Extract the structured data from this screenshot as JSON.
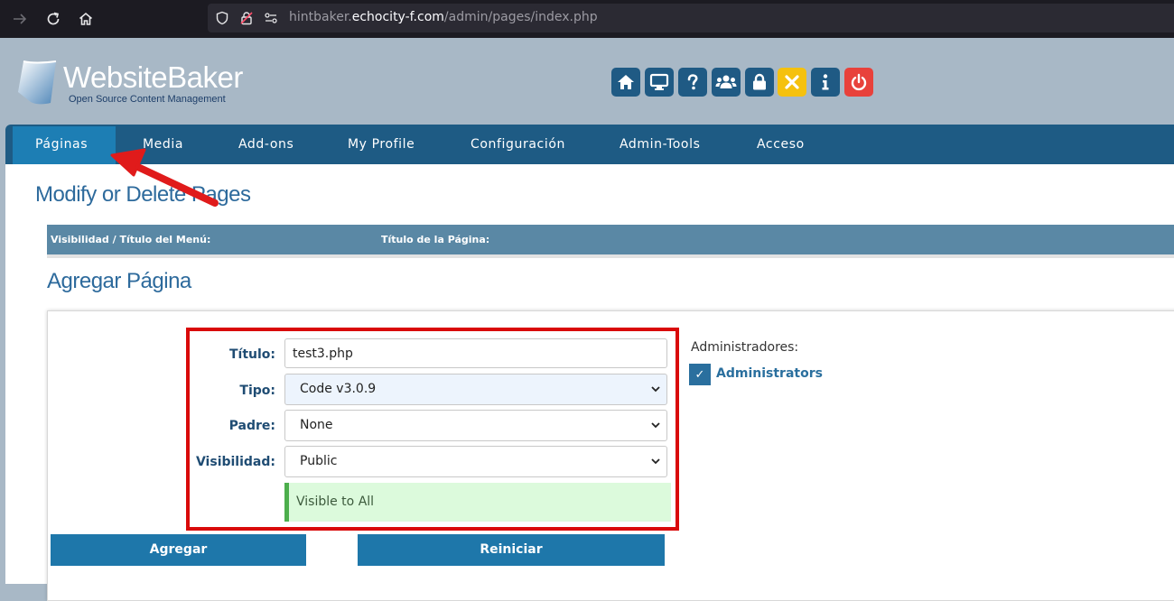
{
  "browser": {
    "url_host_prefix": "hintbaker.",
    "url_domain": "echocity-f.com",
    "url_path": "/admin/pages/index.php"
  },
  "logo": {
    "title": "WebsiteBaker",
    "subtitle": "Open Source Content Management"
  },
  "toolbar": {
    "buttons": [
      {
        "name": "home",
        "color": "#1f5a84"
      },
      {
        "name": "view",
        "color": "#1f5a84"
      },
      {
        "name": "help",
        "color": "#1f5a84"
      },
      {
        "name": "users",
        "color": "#1f5a84"
      },
      {
        "name": "lock",
        "color": "#1f5a84"
      },
      {
        "name": "close",
        "color": "#f5c10e"
      },
      {
        "name": "info",
        "color": "#1f5a84"
      },
      {
        "name": "logout",
        "color": "#e8413b"
      }
    ]
  },
  "nav": {
    "items": [
      "Páginas",
      "Media",
      "Add-ons",
      "My Profile",
      "Configuración",
      "Admin-Tools",
      "Acceso"
    ],
    "active": "Páginas"
  },
  "main": {
    "title_modify": "Modify or Delete Pages",
    "table_headers": [
      "Visibilidad / Título del Menú:",
      "Título de la Página:"
    ],
    "title_add": "Agregar Página"
  },
  "form": {
    "titulo_label": "Título:",
    "titulo_value": "test3.php",
    "tipo_label": "Tipo:",
    "tipo_value": "Code v3.0.9",
    "padre_label": "Padre:",
    "padre_value": "None",
    "visibilidad_label": "Visibilidad:",
    "visibilidad_value": "Public",
    "visibility_note": "Visible to All",
    "admins_label": "Administradores:",
    "admins_group": "Administrators",
    "admins_checked": true,
    "add_button": "Agregar",
    "reset_button": "Reiniciar"
  },
  "colors": {
    "nav_bg": "#1e5b84",
    "nav_active": "#1d7eb4",
    "heading": "#2d6a9c",
    "button": "#1e77aa",
    "annotation_red": "#d90a0a"
  }
}
